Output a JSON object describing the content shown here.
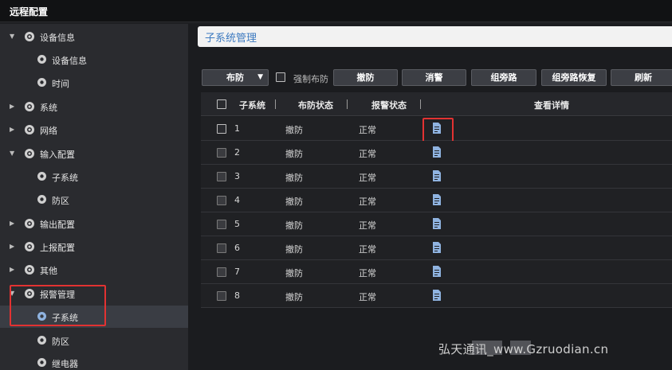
{
  "window": {
    "title": "远程配置"
  },
  "sidebar": {
    "items": [
      {
        "label": "设备信息",
        "level": 0,
        "expanded": true
      },
      {
        "label": "设备信息",
        "level": 1
      },
      {
        "label": "时间",
        "level": 1
      },
      {
        "label": "系统",
        "level": 0,
        "expanded": false
      },
      {
        "label": "网络",
        "level": 0,
        "expanded": false
      },
      {
        "label": "输入配置",
        "level": 0,
        "expanded": true
      },
      {
        "label": "子系统",
        "level": 1
      },
      {
        "label": "防区",
        "level": 1
      },
      {
        "label": "输出配置",
        "level": 0,
        "expanded": false
      },
      {
        "label": "上报配置",
        "level": 0,
        "expanded": false
      },
      {
        "label": "其他",
        "level": 0,
        "expanded": false
      },
      {
        "label": "报警管理",
        "level": 0,
        "expanded": true
      },
      {
        "label": "子系统",
        "level": 1,
        "selected": true
      },
      {
        "label": "防区",
        "level": 1
      },
      {
        "label": "继电器",
        "level": 1
      }
    ]
  },
  "page": {
    "title": "子系统管理"
  },
  "toolbar": {
    "arm_select": "布防",
    "force_arm_label": "强制布防",
    "disarm": "撤防",
    "clear_alarm": "消警",
    "bypass_group": "组旁路",
    "bypass_restore": "组旁路恢复",
    "refresh": "刷新"
  },
  "table": {
    "headers": {
      "subsystem": "子系统",
      "arm_status": "布防状态",
      "alarm_status": "报警状态",
      "details": "查看详情"
    },
    "rows": [
      {
        "id": "1",
        "arm": "撤防",
        "alarm": "正常"
      },
      {
        "id": "2",
        "arm": "撤防",
        "alarm": "正常"
      },
      {
        "id": "3",
        "arm": "撤防",
        "alarm": "正常"
      },
      {
        "id": "4",
        "arm": "撤防",
        "alarm": "正常"
      },
      {
        "id": "5",
        "arm": "撤防",
        "alarm": "正常"
      },
      {
        "id": "6",
        "arm": "撤防",
        "alarm": "正常"
      },
      {
        "id": "7",
        "arm": "撤防",
        "alarm": "正常"
      },
      {
        "id": "8",
        "arm": "撤防",
        "alarm": "正常"
      }
    ]
  },
  "watermark": "弘天通讯_www.Gzruodian.cn",
  "colors": {
    "highlight": "#e23232",
    "accent": "#3d7ac0",
    "icon": "#8fb3e0"
  }
}
